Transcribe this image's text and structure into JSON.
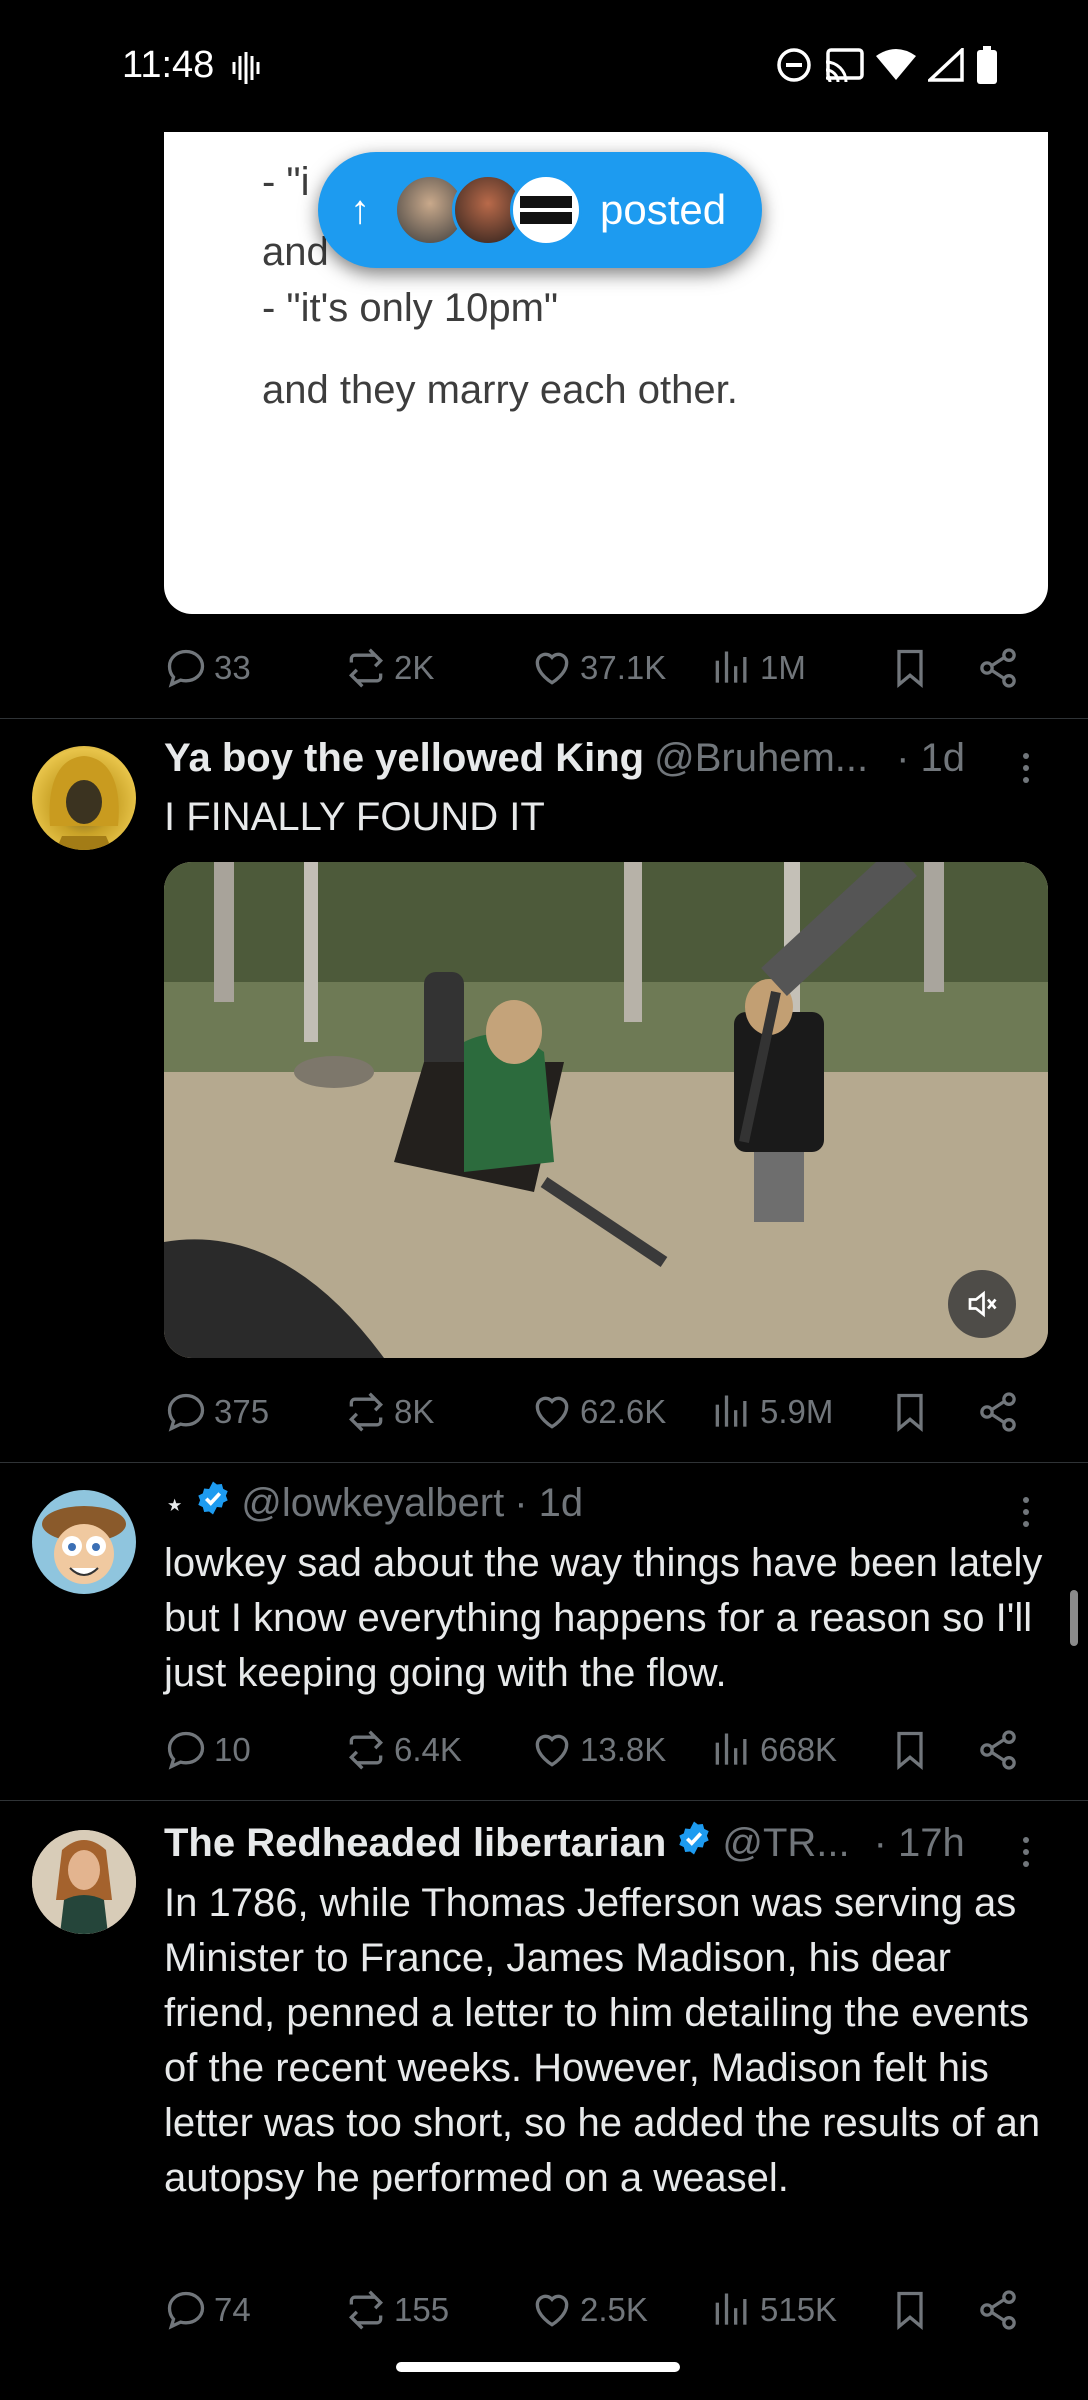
{
  "status_bar": {
    "time": "11:48"
  },
  "floating_pill": {
    "label": "posted"
  },
  "quoted_image": {
    "lines": [
      "- \"i",
      "and",
      "- \"it's only 10pm\"",
      "and they marry each other."
    ]
  },
  "posts": [
    {
      "id": "p0",
      "stats": {
        "replies": "33",
        "reposts": "2K",
        "likes": "37.1K",
        "views": "1M"
      }
    },
    {
      "id": "p1",
      "name": "Ya boy the yellowed King",
      "handle": "@Bruhem...",
      "time": "· 1d",
      "text": "I FINALLY FOUND IT",
      "stats": {
        "replies": "375",
        "reposts": "8K",
        "likes": "62.6K",
        "views": "5.9M"
      }
    },
    {
      "id": "p2",
      "name": "⋆",
      "handle": "@lowkeyalbert",
      "time": "· 1d",
      "text": "lowkey sad about the way things have been lately but I know everything happens for a reason so I'll just keeping going with the flow.",
      "stats": {
        "replies": "10",
        "reposts": "6.4K",
        "likes": "13.8K",
        "views": "668K"
      }
    },
    {
      "id": "p3",
      "name": "The Redheaded libertarian",
      "handle": "@TR...",
      "time": "· 17h",
      "text": "In 1786, while Thomas Jefferson was serving as Minister to France, James Madison, his dear friend, penned a letter to him detailing the events of the recent weeks. However, Madison felt his letter was too short, so he added the results of an autopsy he performed on a weasel.",
      "stats": {
        "replies": "74",
        "reposts": "155",
        "likes": "2.5K",
        "views": "515K"
      }
    }
  ],
  "colors": {
    "accent": "#1d9bf0",
    "background": "#000000",
    "muted": "#71767b",
    "text": "#e7e9ea"
  }
}
